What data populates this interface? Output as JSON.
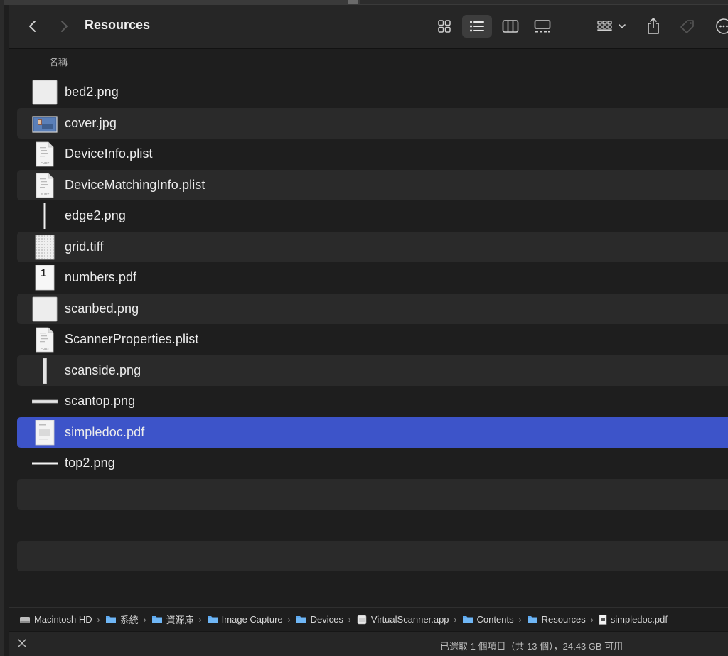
{
  "toolbar": {
    "title": "Resources",
    "back_icon": "chevron-left-icon",
    "forward_icon": "chevron-right-icon",
    "views": [
      "icon-view-icon",
      "list-view-icon",
      "column-view-icon",
      "gallery-view-icon"
    ],
    "active_view": "list-view-icon",
    "group_icon": "group-by-icon",
    "share_icon": "share-icon",
    "tag_icon": "tag-icon",
    "more_icon": "more-icon"
  },
  "list_header": {
    "name_column": "名稱"
  },
  "files": [
    {
      "name": "bed2.png",
      "icon": "image-file-icon"
    },
    {
      "name": "cover.jpg",
      "icon": "jpg-thumbnail-icon"
    },
    {
      "name": "DeviceInfo.plist",
      "icon": "plist-file-icon"
    },
    {
      "name": "DeviceMatchingInfo.plist",
      "icon": "plist-file-icon"
    },
    {
      "name": "edge2.png",
      "icon": "vertical-strip-icon"
    },
    {
      "name": "grid.tiff",
      "icon": "tiff-grid-icon"
    },
    {
      "name": "numbers.pdf",
      "icon": "pdf-number-icon"
    },
    {
      "name": "scanbed.png",
      "icon": "image-file-icon"
    },
    {
      "name": "ScannerProperties.plist",
      "icon": "plist-file-icon"
    },
    {
      "name": "scanside.png",
      "icon": "vertical-strip-icon"
    },
    {
      "name": "scantop.png",
      "icon": "horizontal-strip-icon"
    },
    {
      "name": "simpledoc.pdf",
      "icon": "pdf-doc-icon"
    },
    {
      "name": "top2.png",
      "icon": "horizontal-strip-icon"
    }
  ],
  "selected_file": "simpledoc.pdf",
  "pathbar": [
    {
      "label": "Macintosh HD",
      "icon": "hard-drive-icon"
    },
    {
      "label": "系統",
      "icon": "folder-icon"
    },
    {
      "label": "資源庫",
      "icon": "folder-icon"
    },
    {
      "label": "Image Capture",
      "icon": "folder-icon"
    },
    {
      "label": "Devices",
      "icon": "folder-icon"
    },
    {
      "label": "VirtualScanner.app",
      "icon": "app-icon"
    },
    {
      "label": "Contents",
      "icon": "folder-icon"
    },
    {
      "label": "Resources",
      "icon": "folder-icon"
    },
    {
      "label": "simpledoc.pdf",
      "icon": "pdf-small-icon"
    }
  ],
  "path_separator": "›",
  "status": {
    "text": "已選取 1 個項目（共 13 個），24.43 GB 可用",
    "close_icon": "close-icon"
  },
  "colors": {
    "background": "#1e1e1e",
    "row_alt": "#2a2a2a",
    "selection": "#3d54c9",
    "folder": "#5da9f0"
  }
}
